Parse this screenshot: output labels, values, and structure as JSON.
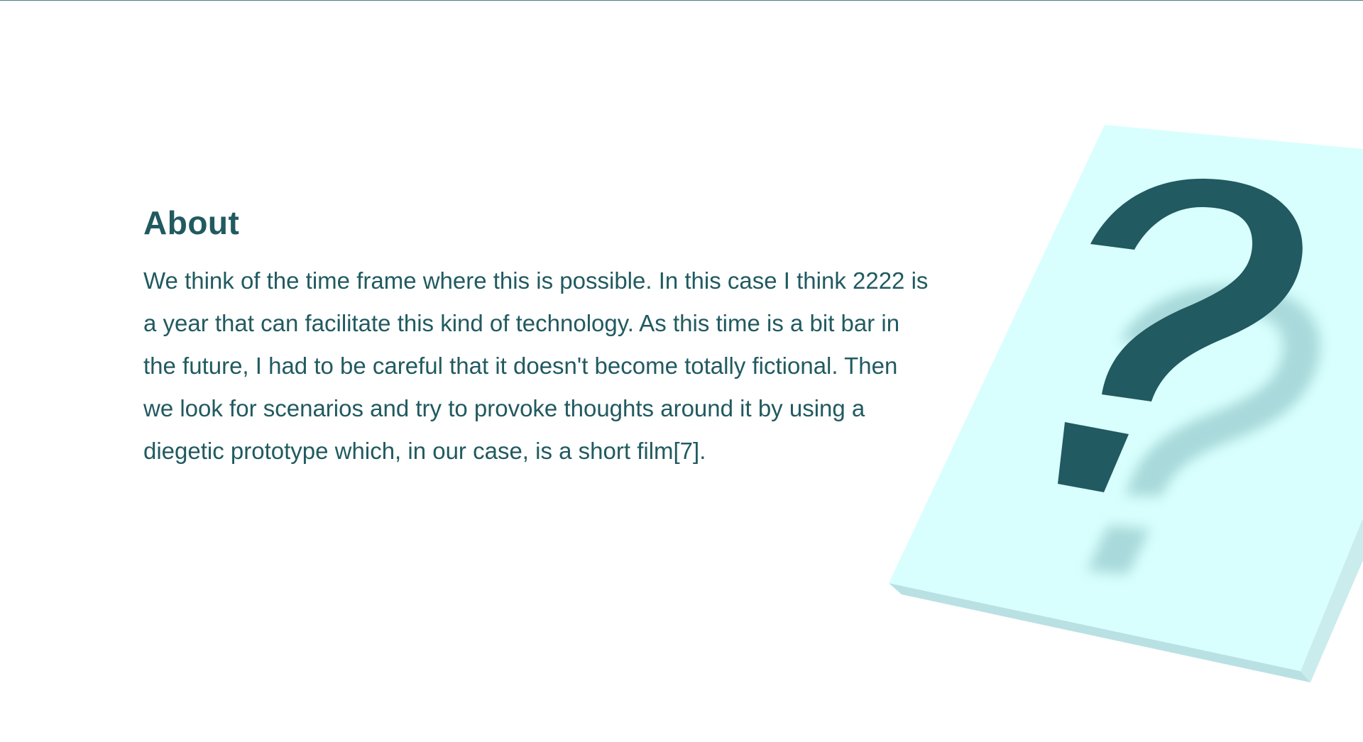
{
  "colors": {
    "text": "#215a60",
    "card_face": "#d8fffe",
    "card_edge": "#b9e1e3",
    "card_edge_side": "#cbeced",
    "mark_shadow": "#a9d9da",
    "top_rule": "#4c7f82"
  },
  "about": {
    "title": "About",
    "body": "We think of the time frame where this is possible. In this case I think 2222 is a year that can facilitate this kind of technology. As this time is a bit bar in the future, I had to be careful that it doesn't become totally fictional. Then we look for scenarios and try to provoke thoughts around it by using a diegetic prototype which, in our case, is a short film[7]."
  },
  "illustration": {
    "glyph": "?",
    "icon": "question-mark-card-icon"
  }
}
